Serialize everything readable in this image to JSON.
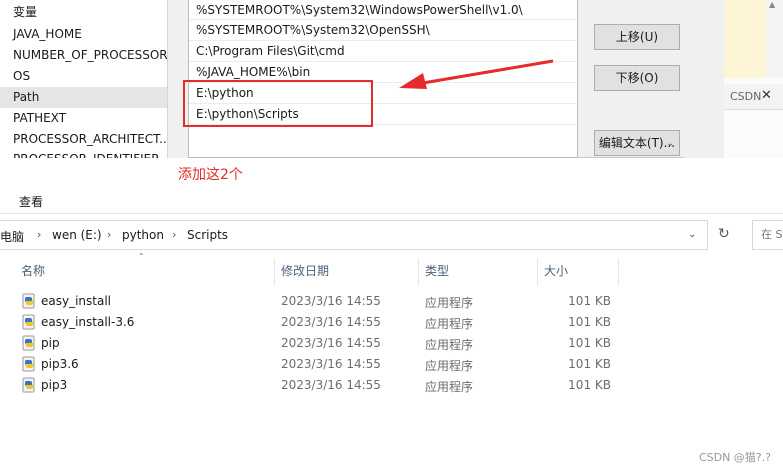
{
  "env_dialog": {
    "variables_header": "变量",
    "variables": [
      "JAVA_HOME",
      "NUMBER_OF_PROCESSORS",
      "OS",
      "Path",
      "PATHEXT",
      "PROCESSOR_ARCHITECT...",
      "PROCESSOR_IDENTIFIER"
    ],
    "selected_variable": "Path",
    "path_entries": [
      "%SYSTEMROOT%\\System32\\WindowsPowerShell\\v1.0\\",
      "%SYSTEMROOT%\\System32\\OpenSSH\\",
      "C:\\Program Files\\Git\\cmd",
      "%JAVA_HOME%\\bin",
      "E:\\python",
      "E:\\python\\Scripts"
    ],
    "buttons": {
      "move_up": "上移(U)",
      "move_down": "下移(O)",
      "edit_text": "编辑文本(T)..."
    },
    "highlight_color": "#e52b2b"
  },
  "annotation": "添加这2个",
  "background_window": {
    "tab_label": "CSDN",
    "close": "✕"
  },
  "explorer": {
    "ribbon_tab": "查看",
    "breadcrumb": [
      "电脑",
      "wen (E:)",
      "python",
      "Scripts"
    ],
    "search_placeholder": "在 S",
    "columns": {
      "name": "名称",
      "modified": "修改日期",
      "type": "类型",
      "size": "大小"
    },
    "files": [
      {
        "name": "easy_install",
        "modified": "2023/3/16 14:55",
        "type": "应用程序",
        "size": "101 KB"
      },
      {
        "name": "easy_install-3.6",
        "modified": "2023/3/16 14:55",
        "type": "应用程序",
        "size": "101 KB"
      },
      {
        "name": "pip",
        "modified": "2023/3/16 14:55",
        "type": "应用程序",
        "size": "101 KB"
      },
      {
        "name": "pip3.6",
        "modified": "2023/3/16 14:55",
        "type": "应用程序",
        "size": "101 KB"
      },
      {
        "name": "pip3",
        "modified": "2023/3/16 14:55",
        "type": "应用程序",
        "size": "101 KB"
      }
    ],
    "file_icon": "python-file-icon"
  },
  "watermark": "CSDN @猫?.?"
}
